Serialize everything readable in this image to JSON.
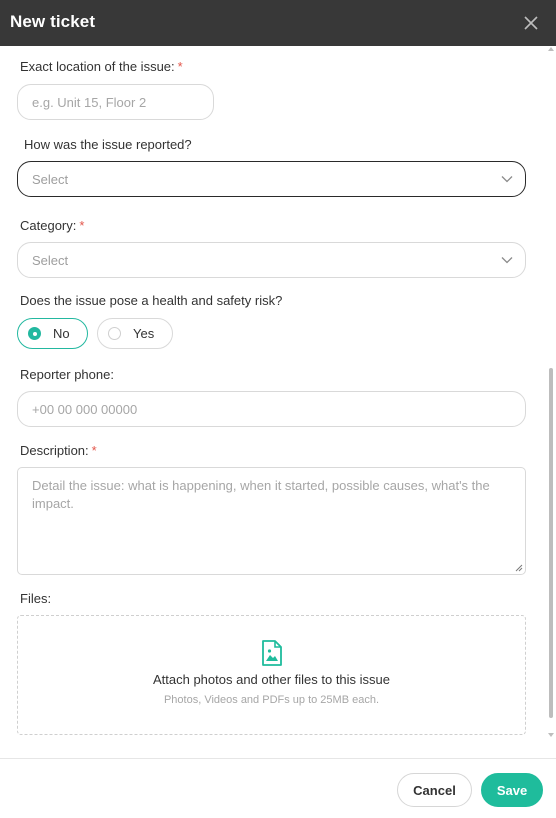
{
  "header": {
    "title": "New ticket"
  },
  "form": {
    "location": {
      "label": "Exact location of the issue:",
      "required_mark": "*",
      "placeholder": "e.g. Unit 15, Floor 2"
    },
    "reported": {
      "label": "How was the issue reported?",
      "placeholder": "Select"
    },
    "category": {
      "label": "Category:",
      "required_mark": "*",
      "placeholder": "Select"
    },
    "health": {
      "label": "Does the issue pose a health and safety risk?",
      "options": [
        {
          "label": "No",
          "checked": true
        },
        {
          "label": "Yes",
          "checked": false
        }
      ]
    },
    "phone": {
      "label": "Reporter phone:",
      "placeholder": "+00 00 000 00000"
    },
    "description": {
      "label": "Description:",
      "required_mark": "*",
      "placeholder": "Detail the issue: what is happening, when it started, possible causes, what's the impact."
    },
    "files": {
      "label": "Files:",
      "title": "Attach photos and other files to this issue",
      "hint": "Photos, Videos and PDFs up to 25MB each."
    }
  },
  "footer": {
    "cancel_label": "Cancel",
    "save_label": "Save"
  },
  "colors": {
    "header_bg": "#383838",
    "accent": "#1fbc9c",
    "required": "#e3554a"
  }
}
